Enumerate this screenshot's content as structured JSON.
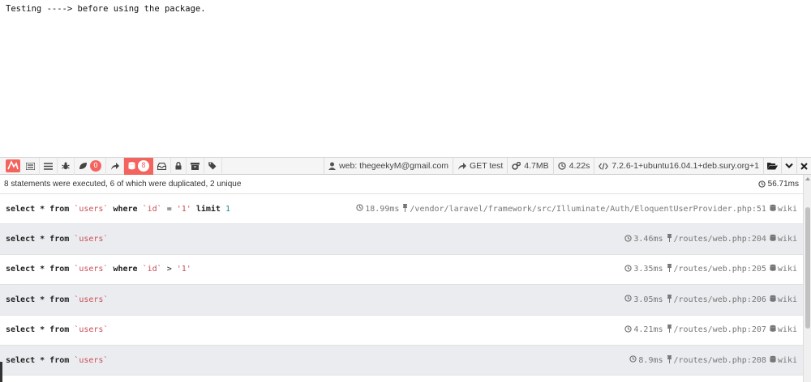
{
  "page": {
    "text": "Testing ----> before using the package."
  },
  "toolbar": {
    "logo_icon": "laravel-logo-icon",
    "tabs": [
      {
        "name": "messages",
        "icon": "list-icon"
      },
      {
        "name": "timeline",
        "icon": "tasks-icon"
      },
      {
        "name": "exceptions",
        "icon": "bug-icon"
      },
      {
        "name": "views",
        "icon": "leaf-icon",
        "badge": "0"
      },
      {
        "name": "route",
        "icon": "share-icon"
      },
      {
        "name": "queries",
        "icon": "database-icon",
        "badge": "8",
        "active": true
      },
      {
        "name": "mail",
        "icon": "inbox-icon"
      },
      {
        "name": "auth",
        "icon": "lock-icon"
      },
      {
        "name": "session",
        "icon": "archive-icon"
      },
      {
        "name": "request",
        "icon": "tags-icon"
      }
    ],
    "user": "web: thegeekyM@gmail.com",
    "route": "GET test",
    "memory": "4.7MB",
    "duration": "4.22s",
    "php_version": "7.2.6-1+ubuntu16.04.1+deb.sury.org+1"
  },
  "queries": {
    "summary": "8 statements were executed, 6 of which were duplicated, 2 unique",
    "total_time": "56.71ms",
    "wiki_label": "wiki",
    "rows": [
      {
        "sql": [
          [
            "kw",
            "select * from "
          ],
          [
            "ident",
            "`users`"
          ],
          [
            "kw",
            " where "
          ],
          [
            "ident",
            "`id`"
          ],
          [
            "plain",
            " = "
          ],
          [
            "str",
            "'1'"
          ],
          [
            "kw",
            " limit "
          ],
          [
            "num",
            "1"
          ]
        ],
        "time": "18.99ms",
        "source": "/vendor/laravel/framework/src/Illuminate/Auth/EloquentUserProvider.php:51"
      },
      {
        "sql": [
          [
            "kw",
            "select * from "
          ],
          [
            "ident",
            "`users`"
          ]
        ],
        "time": "3.46ms",
        "source": "/routes/web.php:204"
      },
      {
        "sql": [
          [
            "kw",
            "select * from "
          ],
          [
            "ident",
            "`users`"
          ],
          [
            "kw",
            " where "
          ],
          [
            "ident",
            "`id`"
          ],
          [
            "plain",
            " > "
          ],
          [
            "str",
            "'1'"
          ]
        ],
        "time": "3.35ms",
        "source": "/routes/web.php:205"
      },
      {
        "sql": [
          [
            "kw",
            "select * from "
          ],
          [
            "ident",
            "`users`"
          ]
        ],
        "time": "3.05ms",
        "source": "/routes/web.php:206"
      },
      {
        "sql": [
          [
            "kw",
            "select * from "
          ],
          [
            "ident",
            "`users`"
          ]
        ],
        "time": "4.21ms",
        "source": "/routes/web.php:207"
      },
      {
        "sql": [
          [
            "kw",
            "select * from "
          ],
          [
            "ident",
            "`users`"
          ]
        ],
        "time": "8.9ms",
        "source": "/routes/web.php:208"
      }
    ]
  },
  "colors": {
    "accent": "#f4645f",
    "alt_row": "#ebecef",
    "identifier": "#c94f57",
    "number": "#1b8a8a"
  }
}
